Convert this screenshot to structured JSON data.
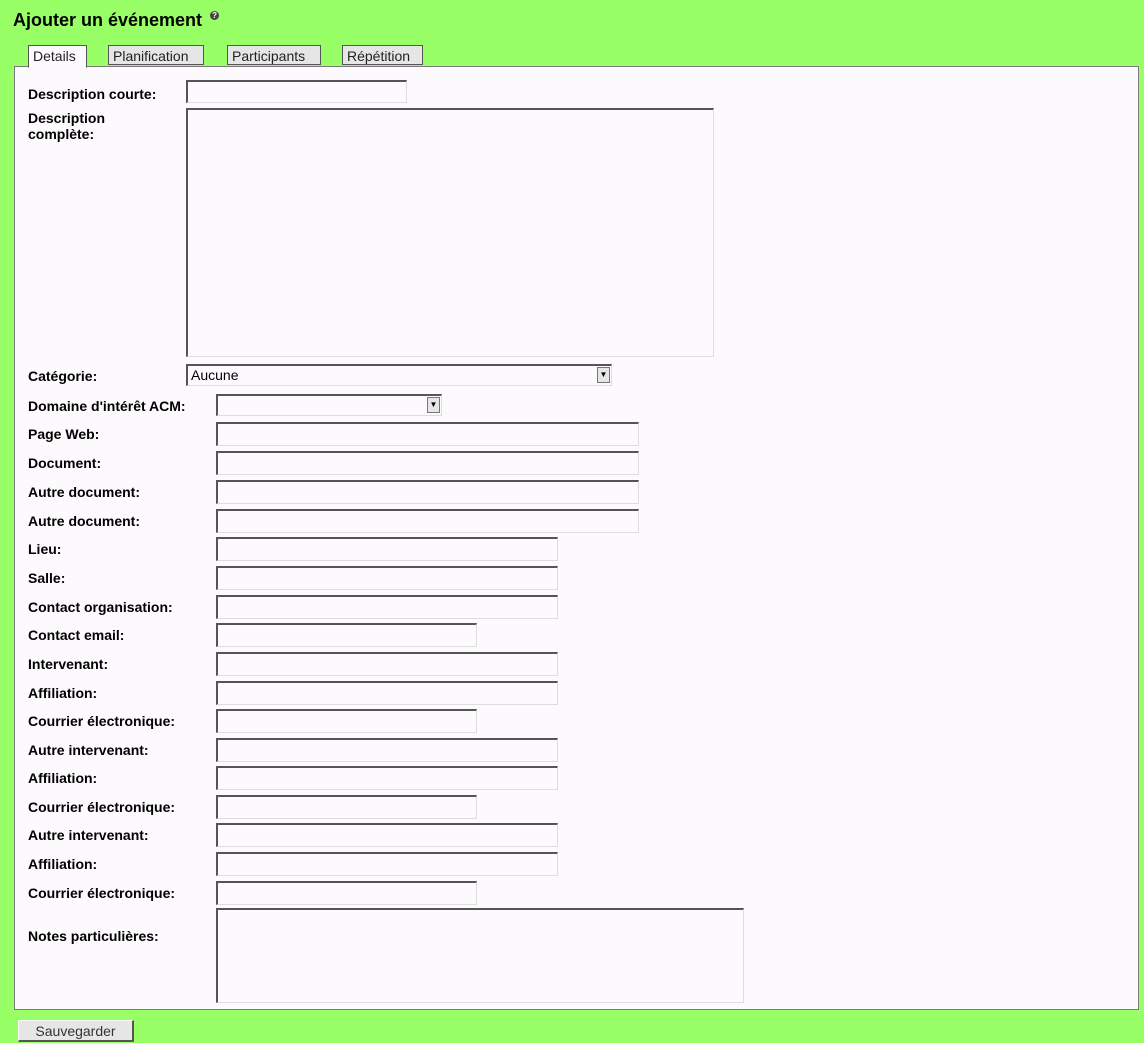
{
  "header": {
    "title": "Ajouter un événement",
    "help_icon": "?"
  },
  "tabs": [
    {
      "label": "Details",
      "active": true
    },
    {
      "label": "Planification",
      "active": false
    },
    {
      "label": "Participants",
      "active": false
    },
    {
      "label": "Répétition",
      "active": false
    }
  ],
  "form": {
    "short_description_label": "Description courte:",
    "full_description_label_line1": "Description",
    "full_description_label_line2": "complète:",
    "category_label": "Catégorie:",
    "category_value": "Aucune",
    "domain_label": "Domaine d'intérêt ACM:",
    "domain_value": "",
    "web_page_label": "Page Web:",
    "document_label": "Document:",
    "other_document_label": "Autre document:",
    "other_document2_label": "Autre document:",
    "place_label": "Lieu:",
    "room_label": "Salle:",
    "contact_org_label": "Contact organisation:",
    "contact_email_label": "Contact email:",
    "speaker_label": "Intervenant:",
    "affiliation_label": "Affiliation:",
    "email_label": "Courrier électronique:",
    "other_speaker_label": "Autre intervenant:",
    "affiliation2_label": "Affiliation:",
    "email2_label": "Courrier électronique:",
    "other_speaker2_label": "Autre intervenant:",
    "affiliation3_label": "Affiliation:",
    "email3_label": "Courrier électronique:",
    "notes_label": "Notes particulières:"
  },
  "footer": {
    "save_label": "Sauvegarder"
  }
}
